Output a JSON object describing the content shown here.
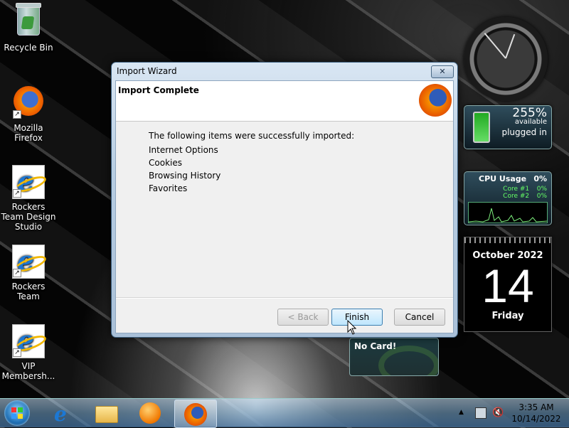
{
  "desktop": {
    "icons": [
      {
        "label": "Recycle Bin"
      },
      {
        "label": "Mozilla Firefox"
      },
      {
        "label": "Rockers Team Design Studio"
      },
      {
        "label": "Rockers Team"
      },
      {
        "label": "VIP Membersh..."
      }
    ]
  },
  "gadgets": {
    "battery": {
      "percent": "255%",
      "status": "available",
      "plug": "plugged in"
    },
    "cpu": {
      "title": "CPU Usage",
      "total": "0%",
      "cores": [
        {
          "name": "Core #1",
          "value": "0%"
        },
        {
          "name": "Core #2",
          "value": "0%"
        }
      ]
    },
    "calendar": {
      "month": "October 2022",
      "day": "14",
      "weekday": "Friday"
    },
    "nvidia": {
      "text": "No Card!"
    }
  },
  "dialog": {
    "title": "Import Wizard",
    "heading": "Import Complete",
    "message": "The following items were successfully imported:",
    "items": [
      "Internet Options",
      "Cookies",
      "Browsing History",
      "Favorites"
    ],
    "buttons": {
      "back": "< Back",
      "finish": "Finish",
      "cancel": "Cancel"
    }
  },
  "taskbar": {
    "time": "3:35 AM",
    "date": "10/14/2022",
    "apps": [
      "internet-explorer",
      "windows-explorer",
      "media-player",
      "firefox"
    ]
  },
  "colors": {
    "dialog_frame": "#b7cde2",
    "taskbar": "#78aad2",
    "accent": "#3c7fb1"
  }
}
